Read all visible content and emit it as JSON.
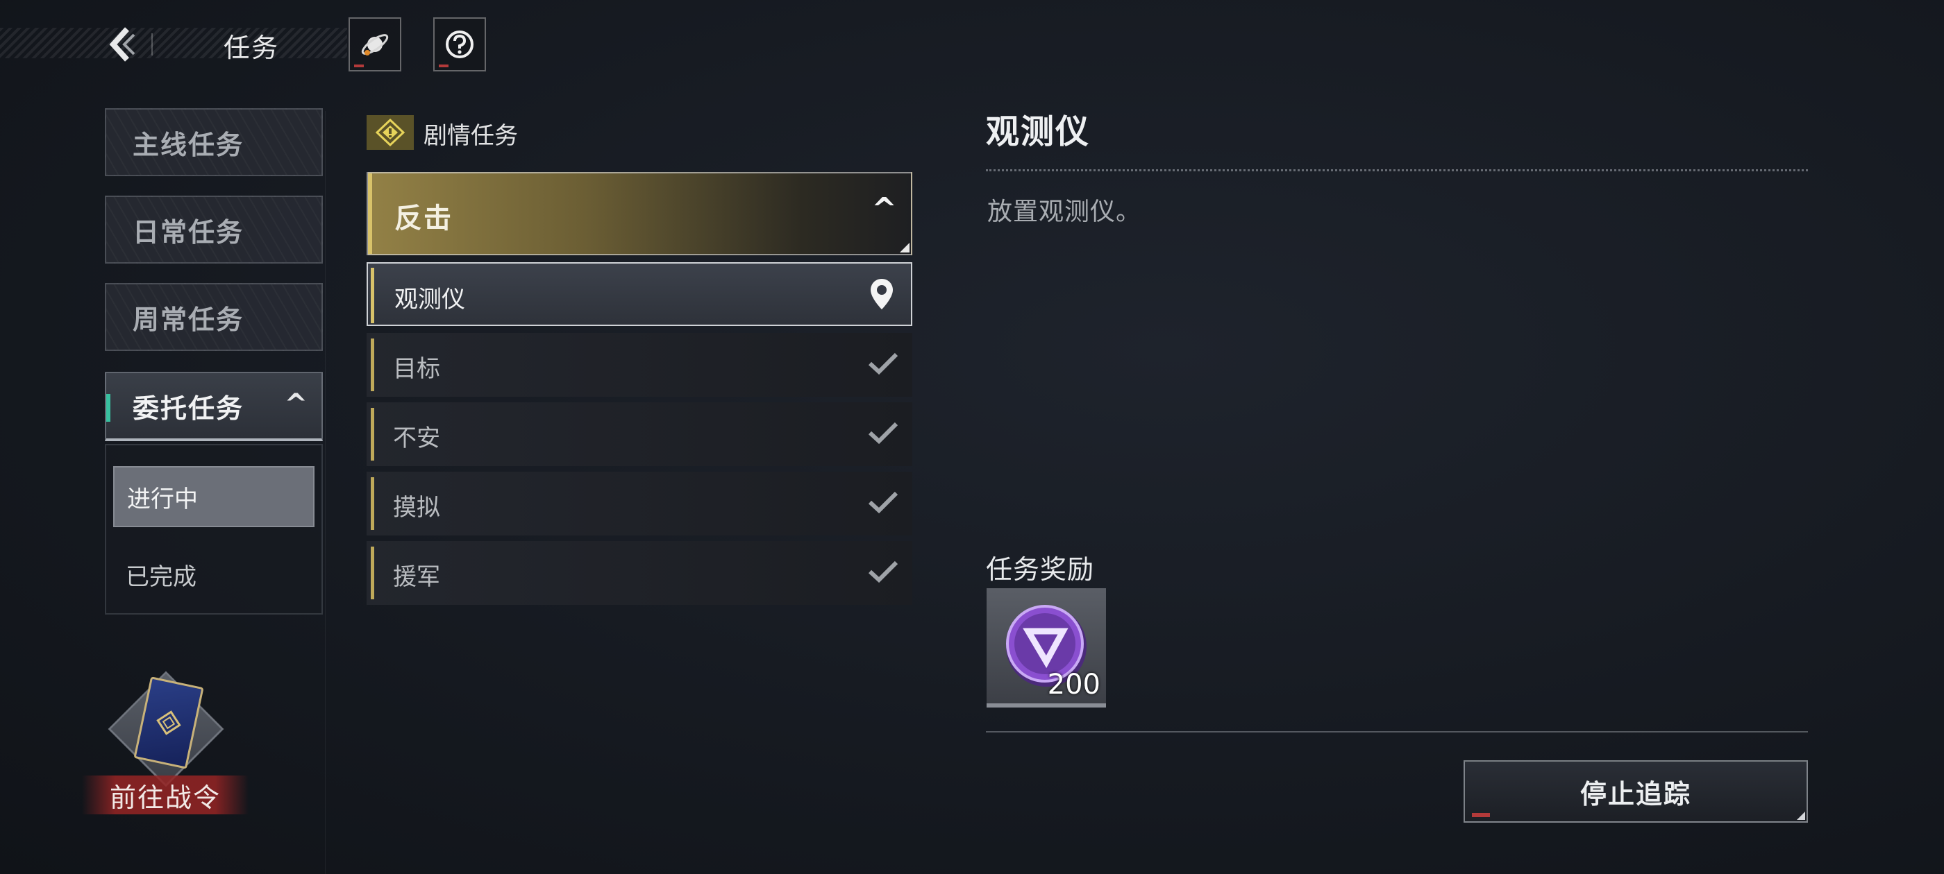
{
  "header": {
    "title": "任务",
    "back_icon": "back-chevron-icon",
    "icon_buttons": [
      "planet-icon",
      "help-icon"
    ]
  },
  "categories": [
    {
      "label": "主线任务",
      "active": false
    },
    {
      "label": "日常任务",
      "active": false
    },
    {
      "label": "周常任务",
      "active": false
    },
    {
      "label": "委托任务",
      "active": true
    }
  ],
  "subfilters": [
    {
      "label": "进行中",
      "active": true
    },
    {
      "label": "已完成",
      "active": false
    }
  ],
  "battle_pass": {
    "label": "前往战令"
  },
  "quest_group": {
    "label": "剧情任务",
    "icon": "story-diamond-icon"
  },
  "quest_chapter": {
    "title": "反击",
    "expanded": true
  },
  "quests": [
    {
      "label": "观测仪",
      "status": "tracking",
      "icon": "location-pin-icon"
    },
    {
      "label": "目标",
      "status": "done",
      "icon": "check-icon"
    },
    {
      "label": "不安",
      "status": "done",
      "icon": "check-icon"
    },
    {
      "label": "摸拟",
      "status": "done",
      "icon": "check-icon"
    },
    {
      "label": "援军",
      "status": "done",
      "icon": "check-icon"
    }
  ],
  "detail": {
    "title": "观测仪",
    "description": "放置观测仪。",
    "reward_heading": "任务奖励",
    "rewards": [
      {
        "icon": "purple-coin-icon",
        "count": "200"
      }
    ],
    "stop_button": "停止追踪"
  },
  "colors": {
    "accent_gold": "#d8c26a",
    "accent_teal": "#38c0a0",
    "reward_purple": "#8a4fd0"
  }
}
